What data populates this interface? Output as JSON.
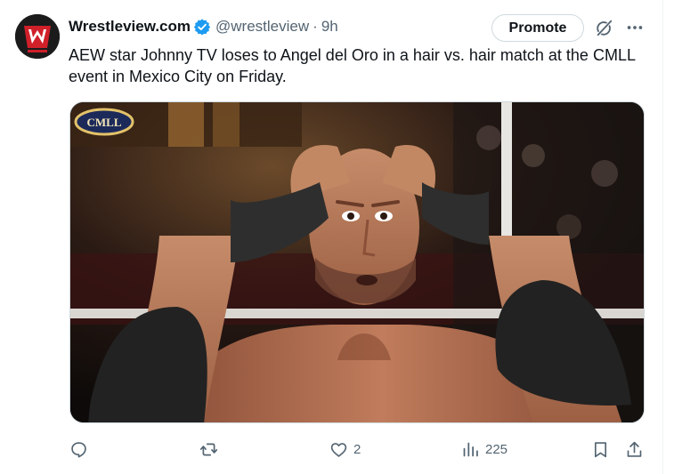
{
  "post": {
    "author": {
      "display_name": "Wrestleview.com",
      "handle": "@wrestleview",
      "separator": "·",
      "time": "9h"
    },
    "promote_label": "Promote",
    "text": "AEW star Johnny TV loses to Angel del Oro in a hair vs. hair match at the CMLL event in Mexico City on Friday.",
    "media": {
      "logo_text": "CMLL"
    },
    "actions": {
      "replies_count": "",
      "reposts_count": "",
      "likes_count": "2",
      "views_count": "225"
    }
  },
  "colors": {
    "text_primary": "#0f1419",
    "text_secondary": "#536471",
    "verified_blue": "#1d9bf0",
    "border": "#cfd9de",
    "avatar_red": "#d0202a"
  },
  "icons": [
    "verified-badge-icon",
    "grok-icon",
    "more-icon",
    "reply-icon",
    "repost-icon",
    "like-icon",
    "views-icon",
    "bookmark-icon",
    "share-icon"
  ]
}
